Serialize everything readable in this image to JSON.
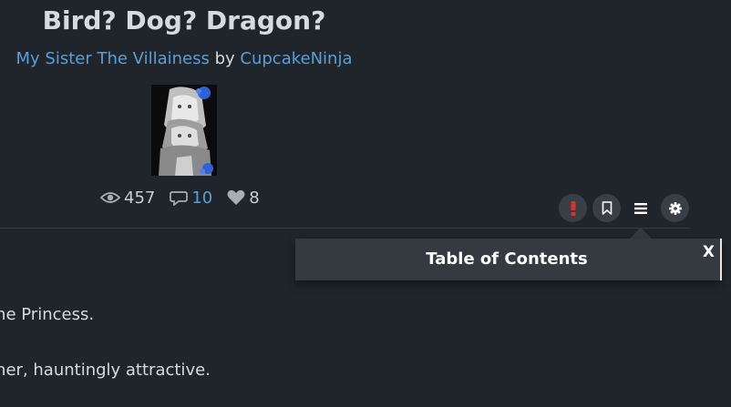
{
  "chapter": {
    "title": "Bird? Dog? Dragon?",
    "story_title": "My Sister The Villainess",
    "by_text": "by",
    "author": "CupcakeNinja"
  },
  "stats": {
    "views": "457",
    "comments": "10",
    "likes": "8"
  },
  "toolbar": {
    "report_icon": "exclamation-icon",
    "bookmark_icon": "bookmark-icon",
    "toc_icon": "list-icon",
    "settings_icon": "gear-icon",
    "report_color": "#d9302c"
  },
  "toc_panel": {
    "title": "Table of Contents",
    "close_label": "X"
  },
  "content": {
    "line1": "the Princess.",
    "line2": "ther, hauntingly attractive."
  },
  "colors": {
    "background": "#20252c",
    "link": "#5a9fd6",
    "panel": "#353a41"
  }
}
